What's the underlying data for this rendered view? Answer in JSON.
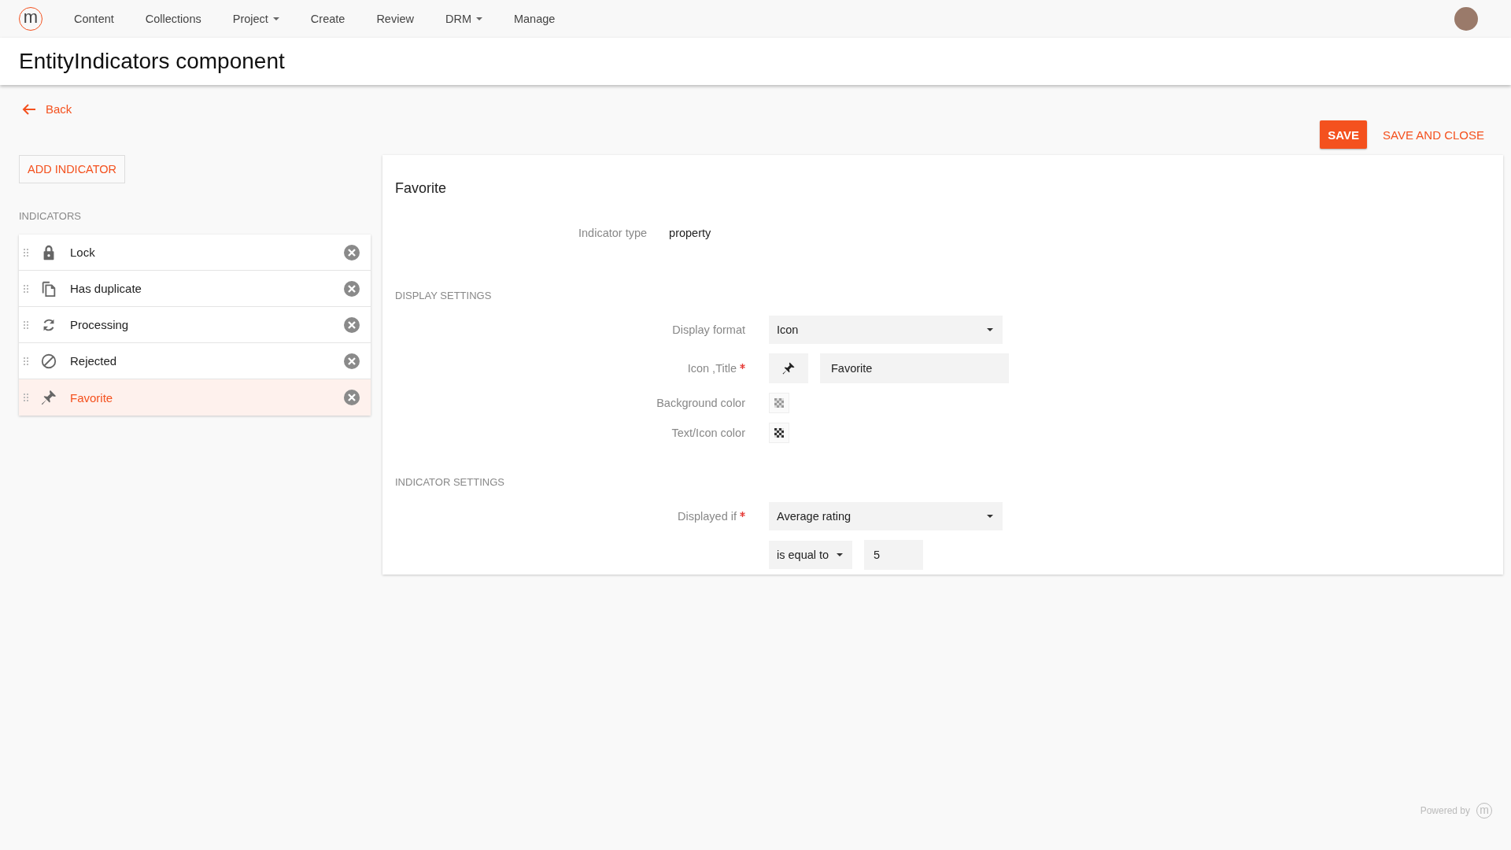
{
  "nav": {
    "logo": "m",
    "items": [
      {
        "label": "Content",
        "dropdown": false
      },
      {
        "label": "Collections",
        "dropdown": false
      },
      {
        "label": "Project",
        "dropdown": true
      },
      {
        "label": "Create",
        "dropdown": false
      },
      {
        "label": "Review",
        "dropdown": false
      },
      {
        "label": "DRM",
        "dropdown": true
      },
      {
        "label": "Manage",
        "dropdown": false
      }
    ]
  },
  "page_title": "EntityIndicators component",
  "back_link": "Back",
  "actions": [
    {
      "label": "SAVE",
      "kind": "primary"
    },
    {
      "label": "SAVE AND CLOSE",
      "kind": "link"
    }
  ],
  "add_button": "ADD INDICATOR",
  "indicators": {
    "heading": "INDICATORS",
    "items": [
      {
        "label": "Lock",
        "kind": "lock",
        "selected": false
      },
      {
        "label": "Has duplicate",
        "kind": "duplicate",
        "selected": false
      },
      {
        "label": "Processing",
        "kind": "processing",
        "selected": false
      },
      {
        "label": "Rejected",
        "kind": "rejected",
        "selected": false
      },
      {
        "label": "Favorite",
        "kind": "pin",
        "selected": true
      }
    ]
  },
  "detail": {
    "title": "Favorite",
    "indicator_type": {
      "label": "Indicator type",
      "value": "property"
    },
    "sections": [
      {
        "heading": "DISPLAY SETTINGS",
        "fields": [
          {
            "label": "Display format",
            "required": false,
            "kind": "select",
            "value": "Icon"
          },
          {
            "label": "Icon ,Title",
            "required": true,
            "kind": "icon_title",
            "value": "Favorite"
          },
          {
            "label": "Background color",
            "required": false,
            "kind": "swatch",
            "color": "#999999"
          },
          {
            "label": "Text/Icon color",
            "required": false,
            "kind": "swatch",
            "color": "#333333"
          }
        ]
      },
      {
        "heading": "INDICATOR SETTINGS",
        "fields": [
          {
            "label": "Displayed if",
            "required": true,
            "kind": "select",
            "value": "Average rating"
          },
          {
            "kind": "condition",
            "operator": "is equal to",
            "value": "5"
          }
        ]
      }
    ]
  },
  "footer": {
    "text": "Powered by",
    "logo": "m"
  }
}
